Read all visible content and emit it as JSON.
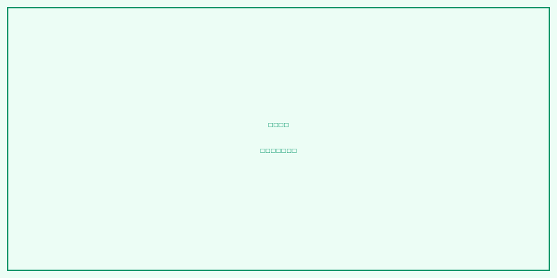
{
  "palette": {
    "background": "#ecfdf5",
    "border": "#059669",
    "text": "#059669"
  },
  "message": {
    "line1": "□□□□",
    "line2": "□□□□□□□"
  }
}
